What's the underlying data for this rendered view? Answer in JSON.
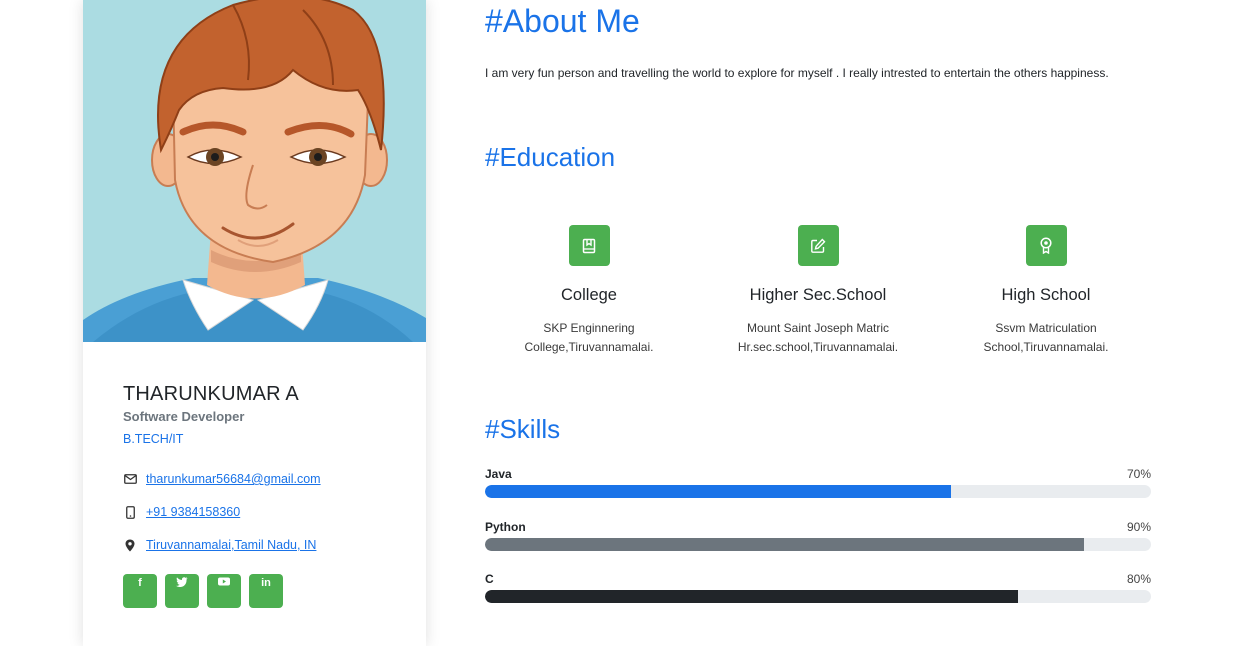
{
  "profile": {
    "name": "THARUNKUMAR A",
    "role": "Software Developer",
    "degree": "B.TECH/IT",
    "avatar_icon": "cartoon-boy-avatar",
    "contacts": [
      {
        "icon": "envelope-icon",
        "text": "tharunkumar56684@gmail.com"
      },
      {
        "icon": "mobile-phone-icon",
        "text": "+91 9384158360"
      },
      {
        "icon": "map-marker-icon",
        "text": "Tiruvannamalai,Tamil Nadu, IN"
      }
    ],
    "social": [
      {
        "icon": "facebook-icon",
        "glyph": "f"
      },
      {
        "icon": "twitter-icon",
        "glyph": "🐦"
      },
      {
        "icon": "youtube-icon",
        "glyph": "▶"
      },
      {
        "icon": "linkedin-icon",
        "glyph": "in"
      }
    ]
  },
  "about": {
    "title": "#About Me",
    "text": "I am very fun person and travelling the world to explore for myself . I really intrested to entertain the others happiness."
  },
  "education": {
    "title": "#Education",
    "items": [
      {
        "icon": "book-icon",
        "name": "College",
        "desc_line1": "SKP Enginnering",
        "desc_line2": "College,Tiruvannamalai."
      },
      {
        "icon": "pencil-square-icon",
        "name": "Higher Sec.School",
        "desc_line1": "Mount Saint Joseph Matric",
        "desc_line2": "Hr.sec.school,Tiruvannamalai."
      },
      {
        "icon": "award-icon",
        "name": "High School",
        "desc_line1": "Ssvm Matriculation",
        "desc_line2": "School,Tiruvannamalai."
      }
    ]
  },
  "skills": {
    "title": "#Skills",
    "items": [
      {
        "name": "Java",
        "percent_label": "70%",
        "level": 0.7,
        "color": "#1a73e8"
      },
      {
        "name": "Python",
        "percent_label": "90%",
        "level": 0.9,
        "color": "#6c757d"
      },
      {
        "name": "C",
        "percent_label": "80%",
        "level": 0.8,
        "color": "#212529"
      }
    ]
  },
  "colors": {
    "accent": "#1a73e8",
    "green": "#4caf50",
    "avatar_bg": "#abdce2"
  }
}
